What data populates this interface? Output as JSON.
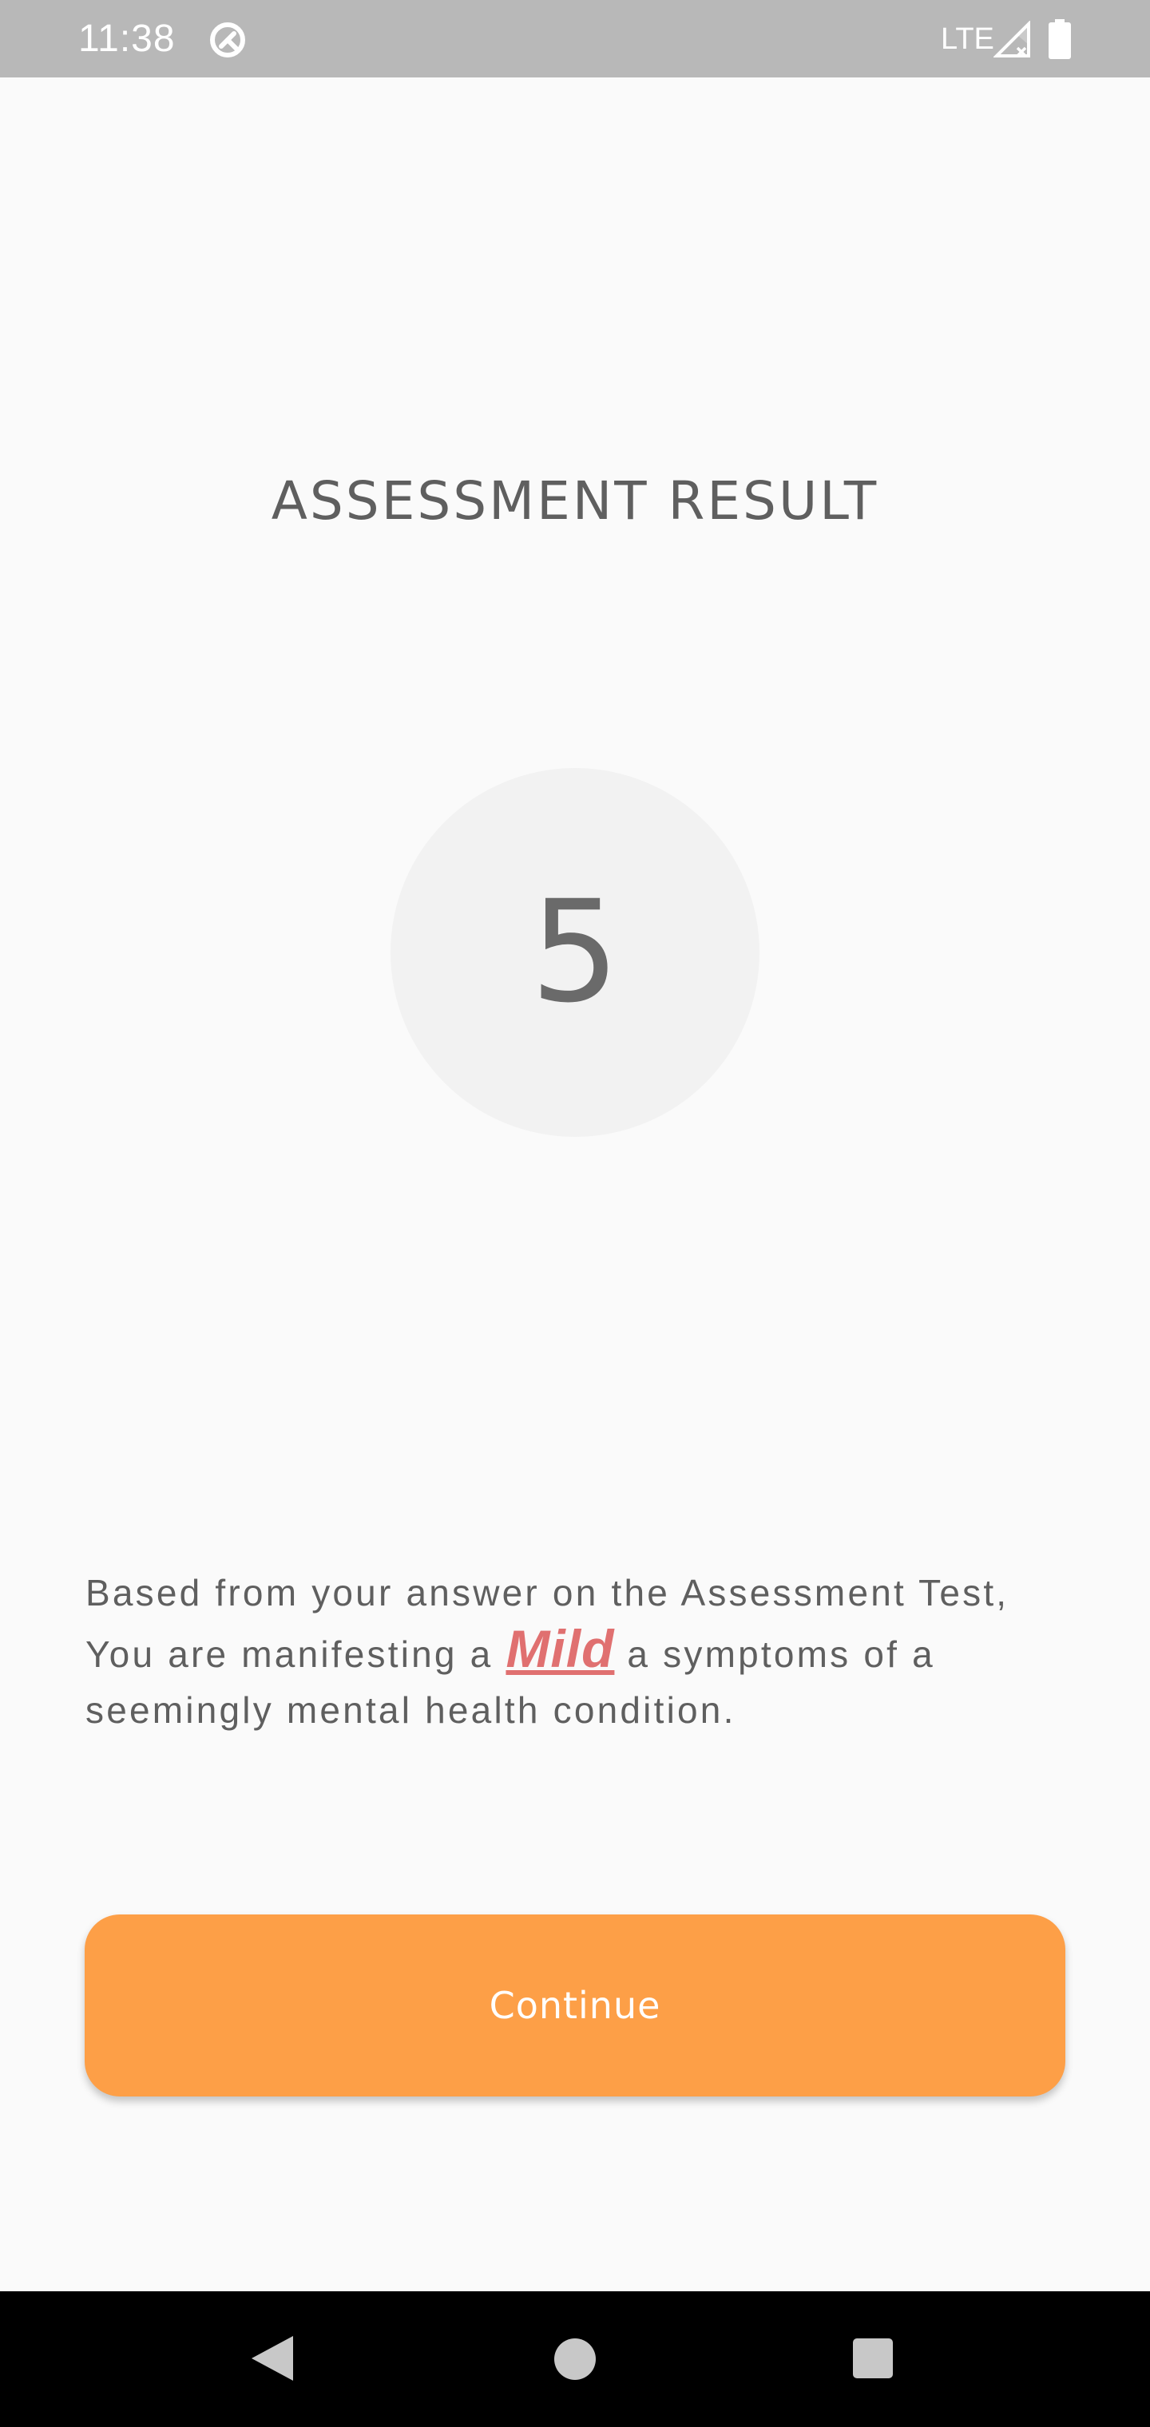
{
  "status_bar": {
    "time": "11:38",
    "network": "LTE",
    "icons": [
      "app-notification-icon",
      "signal-icon",
      "battery-icon"
    ]
  },
  "assessment": {
    "title": "ASSESSMENT RESULT",
    "score": "5",
    "result_prefix": "Based from your answer on the Assessment Test, You are manifesting a",
    "severity": "Mild",
    "result_suffix": "a symptoms of a seemingly mental health condition.",
    "continue_label": "Continue"
  },
  "navigation_bar": {
    "buttons": [
      "back-icon",
      "home-icon",
      "recents-icon"
    ]
  },
  "colors": {
    "status_bar": "#b8b8b8",
    "background": "#fafafa",
    "score_circle": "#f2f2f2",
    "severity": "#e07070",
    "button": "#fd9f47"
  }
}
